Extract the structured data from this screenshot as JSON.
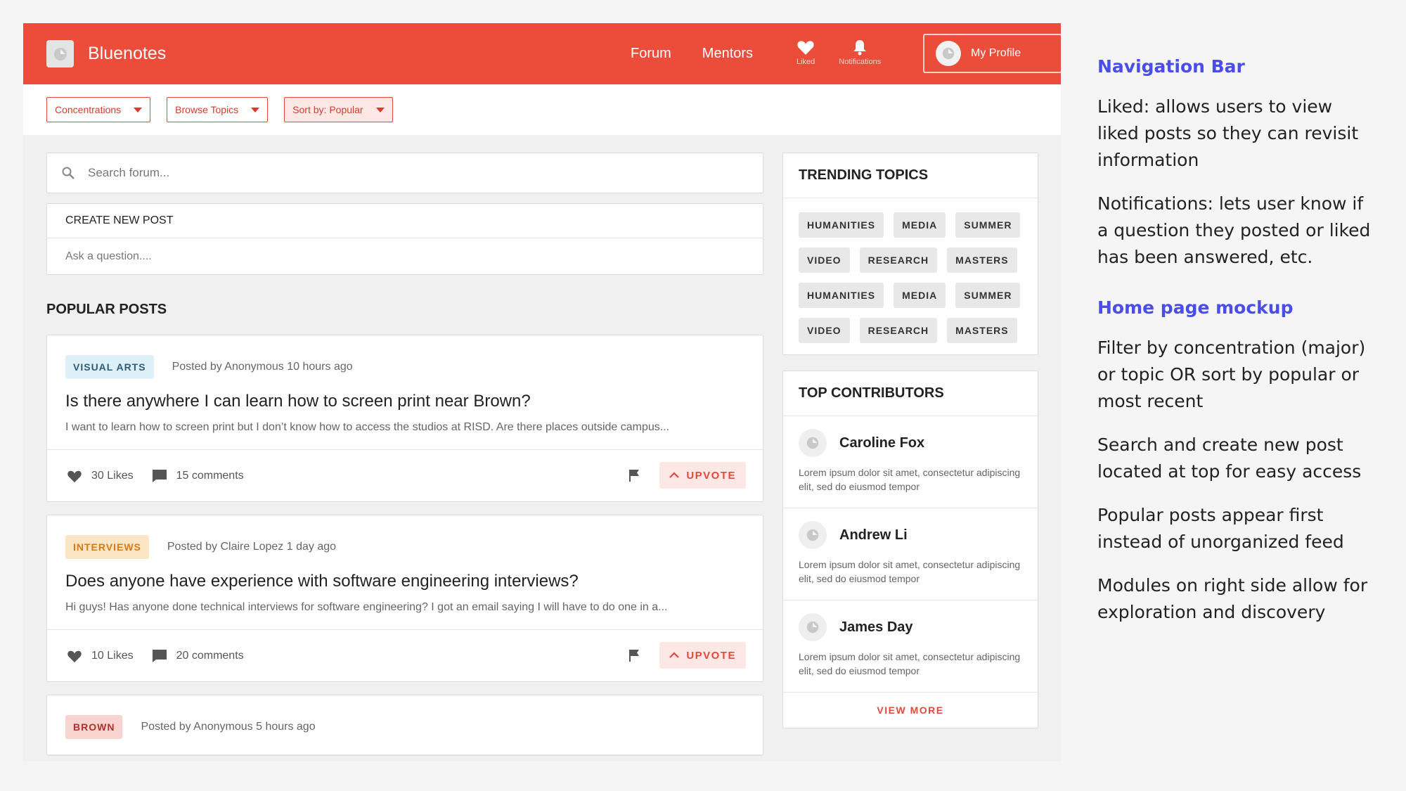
{
  "app": {
    "title": "Bluenotes",
    "nav": [
      "Forum",
      "Mentors"
    ],
    "icons": [
      {
        "icon": "heart-icon",
        "label": "Liked"
      },
      {
        "icon": "bell-icon",
        "label": "Notifications"
      }
    ],
    "profile_label": "My Profile"
  },
  "filters": {
    "concentrations": "Concentrations",
    "topics": "Browse Topics",
    "sort": "Sort by: Popular"
  },
  "search": {
    "placeholder": "Search forum..."
  },
  "create": {
    "title": "CREATE NEW POST",
    "placeholder": "Ask a question...."
  },
  "popular_title": "POPULAR POSTS",
  "posts": [
    {
      "tag": "VISUAL ARTS",
      "meta": "Posted by Anonymous 10 hours ago",
      "title": "Is there anywhere I can learn how to screen print near Brown?",
      "excerpt": "I want to learn how to screen print but I don’t know how to access the studios at RISD. Are there places outside campus...",
      "likes": "30 Likes",
      "comments": "15 comments",
      "upvote": "UPVOTE"
    },
    {
      "tag": "INTERVIEWS",
      "meta": "Posted by Claire Lopez 1 day ago",
      "title": "Does anyone have experience with software engineering interviews?",
      "excerpt": "Hi guys! Has anyone done technical interviews for software engineering? I got an email saying I will have to do one in a...",
      "likes": "10 Likes",
      "comments": "20 comments",
      "upvote": "UPVOTE"
    },
    {
      "tag": "BROWN",
      "meta": "Posted by Anonymous 5 hours ago"
    }
  ],
  "trending": {
    "title": "TRENDING TOPICS",
    "topics": [
      "HUMANITIES",
      "MEDIA",
      "SUMMER",
      "VIDEO",
      "RESEARCH",
      "MASTERS",
      "HUMANITIES",
      "MEDIA",
      "SUMMER",
      "VIDEO",
      "RESEARCH",
      "MASTERS"
    ]
  },
  "contributors": {
    "title": "TOP CONTRIBUTORS",
    "people": [
      {
        "name": "Caroline Fox",
        "bio": "Lorem ipsum dolor sit amet, consectetur adipiscing elit, sed do eiusmod tempor"
      },
      {
        "name": "Andrew Li",
        "bio": "Lorem ipsum dolor sit amet, consectetur adipiscing elit, sed do eiusmod tempor"
      },
      {
        "name": "James Day",
        "bio": "Lorem ipsum dolor sit amet, consectetur adipiscing elit, sed do eiusmod tempor"
      }
    ],
    "view_more": "VIEW MORE"
  },
  "notes": {
    "nav_heading": "Navigation Bar",
    "nav_notes": [
      "Liked: allows users to view liked posts so they can revisit information",
      "Notifications: lets user know if a question they posted or liked has been answered, etc."
    ],
    "home_heading": "Home page mockup",
    "home_notes": [
      "Filter by concentration (major) or topic OR sort by popular or most recent",
      "Search and create new post located at top for easy access",
      "Popular posts appear first instead of unorganized feed",
      "Modules on right side allow for exploration and discovery"
    ]
  },
  "colors": {
    "brand": "#ec4c3a",
    "annotation_heading": "#4a4de8"
  }
}
